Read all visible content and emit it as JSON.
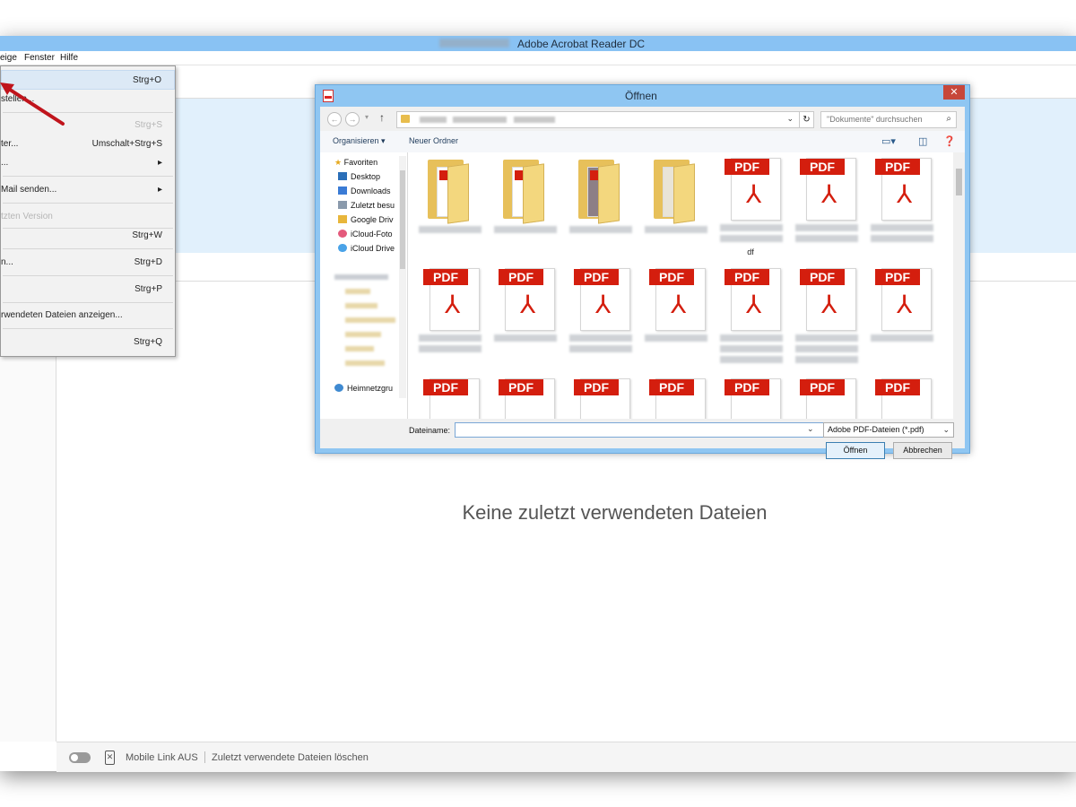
{
  "app": {
    "title": "Adobe Acrobat Reader DC",
    "menu": [
      "Anzeige",
      "Fenster",
      "Hilfe"
    ],
    "menu_visible": [
      "eige",
      "Fenster",
      "Hilfe"
    ],
    "empty_message": "Keine zuletzt verwendeten Dateien",
    "status": {
      "mobile_link": "Mobile Link AUS",
      "clear_recent": "Zuletzt verwendete Dateien löschen"
    }
  },
  "file_menu": {
    "items": [
      {
        "label": "",
        "shortcut": "Strg+O",
        "highlighted": true
      },
      {
        "label": "stellen...",
        "shortcut": ""
      },
      {
        "label": "",
        "shortcut": "Strg+S",
        "disabled": true
      },
      {
        "label": "ter...",
        "shortcut": "Umschalt+Strg+S"
      },
      {
        "label": "...",
        "shortcut": "▸"
      },
      {
        "label": "Mail senden...",
        "shortcut": "▸"
      },
      {
        "label": "tzten Version",
        "shortcut": "",
        "disabled": true
      },
      {
        "label": "",
        "shortcut": "Strg+W"
      },
      {
        "label": "n...",
        "shortcut": "Strg+D"
      },
      {
        "label": "",
        "shortcut": "Strg+P"
      },
      {
        "label": "rwendeten Dateien anzeigen...",
        "shortcut": ""
      },
      {
        "label": "",
        "shortcut": "Strg+Q"
      }
    ]
  },
  "dialog": {
    "title": "Öffnen",
    "close": "✕",
    "search_placeholder": "\"Dokumente\" durchsuchen",
    "commands": {
      "organize": "Organisieren ▾",
      "new_folder": "Neuer Ordner"
    },
    "nav": {
      "favorites_header": "Favoriten",
      "favorites": [
        "Desktop",
        "Downloads",
        "Zuletzt besu",
        "Google Driv",
        "iCloud-Foto",
        "iCloud Drive"
      ],
      "homegroup": "Heimnetzgru"
    },
    "file_caption_visible": "df",
    "file_label": "Dateiname:",
    "file_value": "",
    "file_type": "Adobe PDF-Dateien (*.pdf)",
    "open_button": "Öffnen",
    "cancel_button": "Abbrechen",
    "pdf_tag": "PDF"
  },
  "colors": {
    "titlebar": "#89c2f3",
    "pdf_red": "#d41e0e",
    "banner": "#e1f0fc",
    "annotation_arrow": "#c0141c"
  }
}
